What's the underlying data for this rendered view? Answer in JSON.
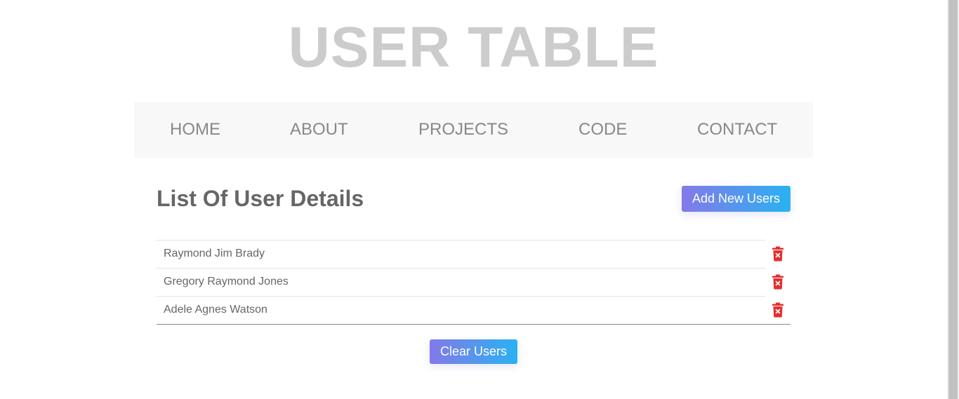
{
  "header": {
    "title": "USER TABLE"
  },
  "nav": {
    "items": [
      {
        "label": "HOME"
      },
      {
        "label": "ABOUT"
      },
      {
        "label": "PROJECTS"
      },
      {
        "label": "CODE"
      },
      {
        "label": "CONTACT"
      }
    ]
  },
  "main": {
    "heading": "List Of User Details",
    "add_button_label": "Add New Users",
    "clear_button_label": "Clear Users",
    "users": [
      {
        "name": "Raymond Jim Brady",
        "action_icon": "trash-delete-icon"
      },
      {
        "name": "Gregory Raymond Jones",
        "action_icon": "trash-delete-icon"
      },
      {
        "name": "Adele Agnes Watson",
        "action_icon": "trash-delete-icon"
      }
    ]
  },
  "colors": {
    "title": "#cccccc",
    "nav_background": "#f8f8f8",
    "nav_text": "#888888",
    "button_gradient_start": "#8379e8",
    "button_gradient_end": "#29b2f2",
    "delete_icon": "#e52e2e",
    "body_text": "#666666"
  }
}
